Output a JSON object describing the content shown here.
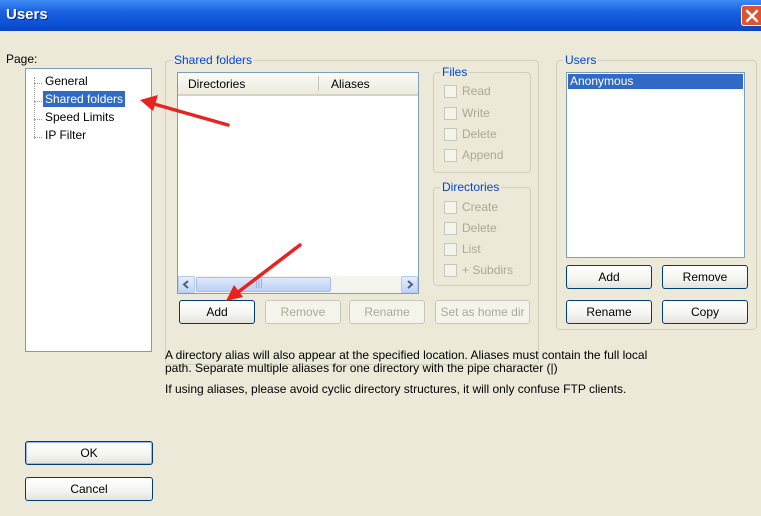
{
  "window": {
    "title": "Users"
  },
  "page_label": "Page:",
  "tree": {
    "items": [
      {
        "label": "General"
      },
      {
        "label": "Shared folders"
      },
      {
        "label": "Speed Limits"
      },
      {
        "label": "IP Filter"
      }
    ]
  },
  "shared_folders": {
    "group_title": "Shared folders",
    "columns": [
      "Directories",
      "Aliases"
    ],
    "buttons": {
      "add": "Add",
      "remove": "Remove",
      "rename": "Rename",
      "home": "Set as home dir"
    },
    "scroll_thumb_grip": "|||"
  },
  "files": {
    "group_title": "Files",
    "options": [
      "Read",
      "Write",
      "Delete",
      "Append"
    ]
  },
  "directories": {
    "group_title": "Directories",
    "options": [
      "Create",
      "Delete",
      "List",
      "+ Subdirs"
    ]
  },
  "users": {
    "group_title": "Users",
    "list": [
      "Anonymous"
    ],
    "buttons": {
      "add": "Add",
      "remove": "Remove",
      "rename": "Rename",
      "copy": "Copy"
    }
  },
  "info": {
    "line1": "A directory alias will also appear at the specified location. Aliases must contain the full local",
    "line2": "path. Separate multiple aliases for one directory with the pipe character (|)",
    "line3": "If using aliases, please avoid cyclic directory structures, it will only confuse FTP clients."
  },
  "dialog_buttons": {
    "ok": "OK",
    "cancel": "Cancel"
  },
  "colors": {
    "accent": "#0046d5",
    "selection": "#316ac5",
    "annotation_arrow": "#e8221e"
  }
}
